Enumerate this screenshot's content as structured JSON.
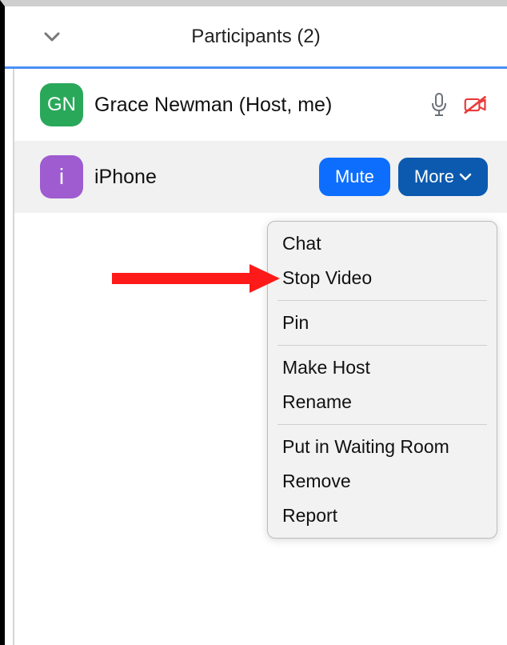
{
  "header": {
    "title": "Participants (2)"
  },
  "participants": [
    {
      "initials": "GN",
      "avatar_color": "green",
      "display": "Grace Newman (Host, me)",
      "mic_muted": false,
      "video_off": true,
      "is_host": true
    },
    {
      "initials": "i",
      "avatar_color": "purple",
      "display": "iPhone",
      "mute_label": "Mute",
      "more_label": "More"
    }
  ],
  "dropdown": {
    "groups": [
      [
        "Chat",
        "Stop Video"
      ],
      [
        "Pin"
      ],
      [
        "Make Host",
        "Rename"
      ],
      [
        "Put in Waiting Room",
        "Remove",
        "Report"
      ]
    ]
  },
  "annotation": {
    "type": "arrow",
    "color": "#ff1a1a",
    "points_to": "Stop Video"
  }
}
